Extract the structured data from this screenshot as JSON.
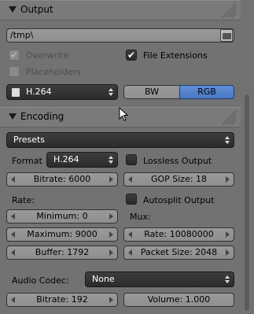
{
  "output": {
    "title": "Output",
    "path_value": "/tmp\\",
    "overwrite_label": "Overwrite",
    "file_extensions_label": "File Extensions",
    "placeholders_label": "Placeholders",
    "format_value": "H.264",
    "color_bw": "BW",
    "color_rgb": "RGB",
    "overwrite_checked": true,
    "file_extensions_checked": true,
    "placeholders_checked": false
  },
  "encoding": {
    "title": "Encoding",
    "presets_label": "Presets",
    "format_label": "Format",
    "format_value": "H.264",
    "lossless_label": "Lossless Output",
    "bitrate": "Bitrate: 6000",
    "gop_size": "GOP Size: 18",
    "rate_label": "Rate:",
    "autosplit_label": "Autosplit Output",
    "minimum": "Minimum: 0",
    "mux_label": "Mux:",
    "maximum": "Maximum: 9000",
    "mux_rate": "Rate: 10080000",
    "buffer": "Buffer: 1792",
    "packet_size": "Packet Size: 2048",
    "audio_codec_label": "Audio Codec:",
    "audio_codec_value": "None",
    "audio_bitrate": "Bitrate: 192",
    "volume": "Volume: 1.000"
  },
  "colors": {
    "panel_bg": "#727272",
    "accent_rgb": "#5680c8",
    "dropdown_bg": "#333333"
  }
}
